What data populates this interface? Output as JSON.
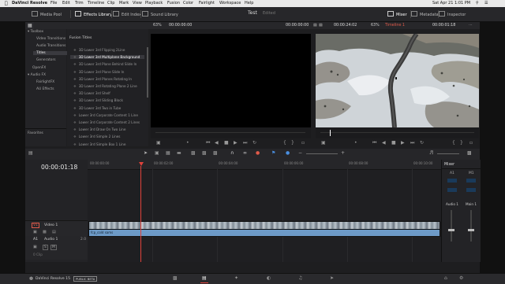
{
  "menubar": {
    "app_name": "DaVinci Resolve",
    "menus": [
      "File",
      "Edit",
      "Trim",
      "Timeline",
      "Clip",
      "Mark",
      "View",
      "Playback",
      "Fusion",
      "Color",
      "Fairlight",
      "Workspace",
      "Help"
    ],
    "clock": "Sat Apr 21  1:01 PM"
  },
  "toolbar": {
    "media_pool": "Media Pool",
    "effects_library": "Effects Library",
    "edit_index": "Edit Index",
    "sound_library": "Sound Library",
    "project_title": "Test",
    "project_status": "Edited",
    "mixer": "Mixer",
    "metadata": "Metadata",
    "inspector": "Inspector"
  },
  "viewer_bar": {
    "src_zoom": "63%",
    "src_timecode": "00:00:00:00",
    "src_timecode_right": "00:00:00:00",
    "src_duration": "00:00:24:02",
    "prg_zoom": "63%",
    "timeline_name": "Timeline 1",
    "prg_timecode": "00:00:01:18"
  },
  "toolbox": {
    "items": [
      {
        "label": "Toolbox",
        "indent": 0
      },
      {
        "label": "Video Transitions",
        "indent": 1
      },
      {
        "label": "Audio Transitions",
        "indent": 1
      },
      {
        "label": "Titles",
        "indent": 1,
        "selected": true
      },
      {
        "label": "Generators",
        "indent": 1
      },
      {
        "label": "OpenFX",
        "indent": 0
      },
      {
        "label": "Audio FX",
        "indent": 0
      },
      {
        "label": "FairlightFX",
        "indent": 1
      },
      {
        "label": "AU Effects",
        "indent": 1
      }
    ],
    "favorites": "Favorites"
  },
  "library": {
    "heading": "Fusion Titles",
    "items": [
      "3D Lower 3rd Flipping 2Line",
      "3D Lower 3rd Multiplane Background",
      "3D Lower 3rd Plane Behind Slide In",
      "3D Lower 3rd Plane Slide In",
      "3D Lower 3rd Planes Rotating In",
      "3D Lower 3rd Rotating Plane 2 Line",
      "3D Lower 3rd Shelf",
      "3D Lower 3rd Sliding Block",
      "3D Lower 3rd Two in Tube",
      "Lower 3rd Corporate Content 1 Line",
      "Lower 3rd Corporate Content 2 Lines",
      "Lower 3rd Draw On Two Line",
      "Lower 3rd Simple 2 Lines",
      "Lower 3rd Simple Box 1 Line"
    ],
    "selected_index": 1
  },
  "timeline": {
    "timecode": "00:00:01:18",
    "ruler": [
      "00:00:00:00",
      "00:00:02:00",
      "00:00:04:00",
      "00:00:06:00",
      "00:00:08:00",
      "00:00:10:00"
    ],
    "v1_label": "V1",
    "v1_name": "Video 1",
    "clip_name": "fcp_cold sams",
    "a1_label": "A1",
    "a1_name": "Audio 1",
    "a1_level": "2.0",
    "a1_clips": "0 Clip"
  },
  "mixer": {
    "title": "Mixer",
    "ch1": "A1",
    "ch2": "M1",
    "audio_label": "Audio 1",
    "main_label": "Main 1"
  },
  "bottombar": {
    "app_label": "DaVinci Resolve 15",
    "beta_badge": "PUBLIC BETA"
  }
}
